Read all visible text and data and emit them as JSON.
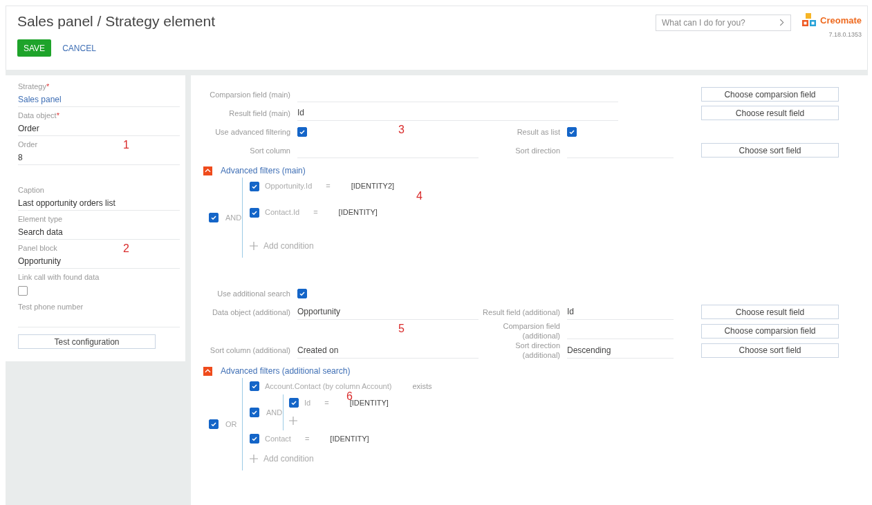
{
  "header": {
    "title": "Sales panel / Strategy element",
    "buttons": [
      {
        "label": "SAVE",
        "kind": "primary"
      },
      {
        "label": "CANCEL",
        "kind": "link"
      }
    ],
    "search": {
      "placeholder": "What can I do for you?"
    },
    "logo": {
      "name": "Creomate",
      "version": "7.18.0.1353"
    }
  },
  "sidebar": {
    "groups": [
      {
        "marker": "1",
        "fields": [
          {
            "label": "Strategy",
            "required_mark": "*",
            "kind": "lookup",
            "value": "Sales panel"
          },
          {
            "label": "Data object",
            "required_mark": "*",
            "kind": "text",
            "value": "Order"
          },
          {
            "label": "Order",
            "kind": "text",
            "value": "8"
          }
        ]
      },
      {
        "marker": "2",
        "fields": [
          {
            "label": "Caption",
            "kind": "text",
            "value": "Last opportunity orders list"
          },
          {
            "label": "Element type",
            "kind": "text",
            "value": "Search data"
          },
          {
            "label": "Panel block",
            "kind": "text",
            "value": "Opportunity"
          },
          {
            "label": "Link call with found data",
            "kind": "checkbox",
            "checked": false
          },
          {
            "label": "Test phone number",
            "kind": "text"
          }
        ]
      }
    ],
    "test_button": "Test configuration"
  },
  "sections": [
    {
      "marker": "3",
      "rows": [
        {
          "left": {
            "label": "Comparsion field (main)",
            "kind": "wide_field"
          },
          "action": "Choose comparsion field"
        },
        {
          "left": {
            "label": "Result field (main)",
            "kind": "wide_field",
            "value": "Id"
          },
          "action": "Choose result field"
        },
        {
          "left": {
            "label": "Use advanced filtering",
            "kind": "checkbox",
            "checked": true
          },
          "middle": {
            "label": "Result as list",
            "kind": "checkbox",
            "checked": true
          }
        },
        {
          "left": {
            "label": "Sort column",
            "kind": "field"
          },
          "middle": {
            "label": "Sort direction",
            "kind": "field"
          },
          "action": "Choose sort field"
        }
      ],
      "filters": {
        "title": "Advanced filters (main)",
        "expanded": true,
        "marker": "4",
        "tree": {
          "kind": "group",
          "operator": "AND",
          "checked": true,
          "add": "Add condition",
          "children": [
            {
              "kind": "condition",
              "checked": true,
              "column": "Opportunity.Id",
              "op": "=",
              "value": "[IDENTITY2]"
            },
            {
              "kind": "condition",
              "checked": true,
              "column": "Contact.Id",
              "op": "=",
              "value": "[IDENTITY]"
            }
          ]
        }
      }
    },
    {
      "marker": "5",
      "rows": [
        {
          "left": {
            "label": "Use additional search",
            "kind": "checkbox",
            "checked": true
          }
        },
        {
          "left": {
            "label": "Data object (additional)",
            "kind": "field",
            "value": "Opportunity"
          },
          "middle": {
            "label": "Result field (additional)",
            "kind": "field",
            "value": "Id"
          },
          "action": "Choose result field"
        },
        {
          "middle": {
            "label": "Comparsion field (additional)",
            "kind": "field"
          },
          "action": "Choose comparsion field"
        },
        {
          "left": {
            "label": "Sort column (additional)",
            "kind": "field",
            "value": "Created on"
          },
          "middle": {
            "label": "Sort direction (additional)",
            "kind": "field",
            "value": "Descending"
          },
          "action": "Choose sort field"
        }
      ],
      "filters": {
        "title": "Advanced filters (additional search)",
        "expanded": true,
        "tree": {
          "kind": "group",
          "operator": "OR",
          "checked": true,
          "add": "Add condition",
          "children": [
            {
              "kind": "exists",
              "checked": true,
              "column": "Account.Contact (by column Account)",
              "op": "exists",
              "marker": "6",
              "group": {
                "kind": "group",
                "operator": "AND",
                "checked": true,
                "children": [
                  {
                    "kind": "condition",
                    "checked": true,
                    "column": "Id",
                    "op": "=",
                    "value": "[IDENTITY]"
                  }
                ]
              }
            },
            {
              "kind": "condition",
              "checked": true,
              "column": "Contact",
              "op": "=",
              "value": "[IDENTITY]"
            }
          ]
        }
      }
    }
  ]
}
